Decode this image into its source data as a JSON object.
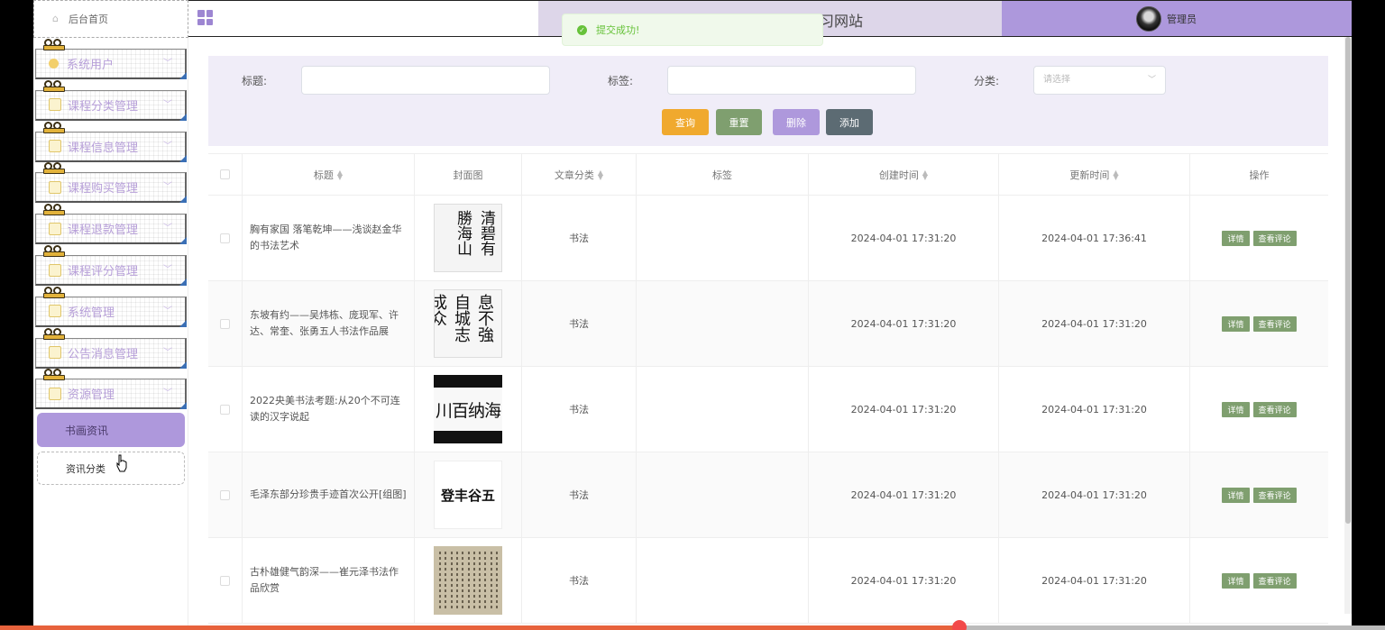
{
  "sidebar": {
    "home_label": "后台首页",
    "menu": [
      {
        "label": "系统用户",
        "icon": "user-icon"
      },
      {
        "label": "课程分类管理",
        "icon": "document-icon"
      },
      {
        "label": "课程信息管理",
        "icon": "document-icon"
      },
      {
        "label": "课程购买管理",
        "icon": "document-icon"
      },
      {
        "label": "课程退款管理",
        "icon": "document-icon"
      },
      {
        "label": "课程评分管理",
        "icon": "document-icon"
      },
      {
        "label": "系统管理",
        "icon": "image-icon"
      },
      {
        "label": "公告消息管理",
        "icon": "info-icon"
      },
      {
        "label": "资源管理",
        "icon": "bulb-icon"
      }
    ],
    "sub_active": "书画资讯",
    "sub_item": "资讯分类"
  },
  "header": {
    "title": "书画鉴赏书画在线学习网站",
    "user_name": "管理员"
  },
  "toast": {
    "message": "提交成功!"
  },
  "search": {
    "title_label": "标题:",
    "tag_label": "标签:",
    "category_label": "分类:",
    "category_placeholder": "请选择",
    "buttons": {
      "query": "查询",
      "reset": "重置",
      "delete": "删除",
      "add": "添加"
    }
  },
  "colors": {
    "query": "#f0a92e",
    "reset": "#7f9f6f",
    "delete": "#ae98dc",
    "add": "#5c6b73"
  },
  "table": {
    "headers": [
      "标题",
      "封面图",
      "文章分类",
      "标签",
      "创建时间",
      "更新时间",
      "操作"
    ],
    "action_detail": "详情",
    "action_comments": "查看评论",
    "rows": [
      {
        "title": "胸有家国 落笔乾坤——浅谈赵金华的书法艺术",
        "category": "书法",
        "tag": "",
        "created": "2024-04-01 17:31:20",
        "updated": "2024-04-01 17:36:41"
      },
      {
        "title": "东坡有约——吴炜栋、庞现军、许达、常奎、张勇五人书法作品展",
        "category": "书法",
        "tag": "",
        "created": "2024-04-01 17:31:20",
        "updated": "2024-04-01 17:31:20"
      },
      {
        "title": "2022央美书法考题:从20个不可连读的汉字说起",
        "category": "书法",
        "tag": "",
        "created": "2024-04-01 17:31:20",
        "updated": "2024-04-01 17:31:20"
      },
      {
        "title": "毛泽东部分珍贵手迹首次公开[组图]",
        "category": "书法",
        "tag": "",
        "created": "2024-04-01 17:31:20",
        "updated": "2024-04-01 17:31:20"
      },
      {
        "title": "古朴雄健气韵深——崔元泽书法作品欣赏",
        "category": "书法",
        "tag": "",
        "created": "2024-04-01 17:31:20",
        "updated": "2024-04-01 17:31:20"
      }
    ]
  },
  "thumbs": [
    {
      "chars": [
        "清碧有",
        "勝海山"
      ]
    },
    {
      "chars": [
        "息不強自",
        "城志成众"
      ]
    },
    {
      "chars": [
        "川百纳海"
      ]
    },
    {
      "chars": [
        "五谷丰登"
      ]
    },
    {
      "chars": []
    }
  ]
}
